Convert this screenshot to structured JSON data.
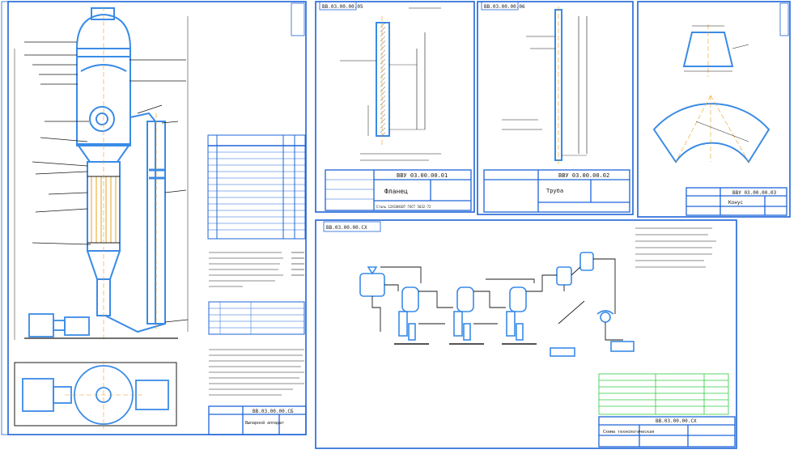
{
  "colors": {
    "background": "#ffffff",
    "frame": "#1e64d8",
    "outline": "#1a1a1a",
    "metal": "#3a8be6",
    "accent": "#e8a020",
    "leader": "#000000"
  },
  "sheets": {
    "main_assembly": {
      "title_code": "ВВ.03.00.00.СБ",
      "stamp_text": "Выпарной аппарат"
    },
    "flange": {
      "header_code": "ВВ.03.00.00.05",
      "title_code": "ВВУ 03.00.00.01",
      "part_name": "Фланец",
      "material": "Сталь 12Х18Н10Т ГОСТ 5632-72"
    },
    "pipe": {
      "header_code": "ВВ.03.00.00.06",
      "title_code": "ВВУ 03.00.00.02",
      "part_name": "Труба"
    },
    "cone": {
      "title_code": "ВВУ 03.00.00.03",
      "part_name": "Конус"
    },
    "scheme": {
      "header_code": "ВВ.03.00.00.СХ",
      "title_code": "ВВ.03.00.00.СХ",
      "part_name": "Схема технологическая"
    }
  }
}
